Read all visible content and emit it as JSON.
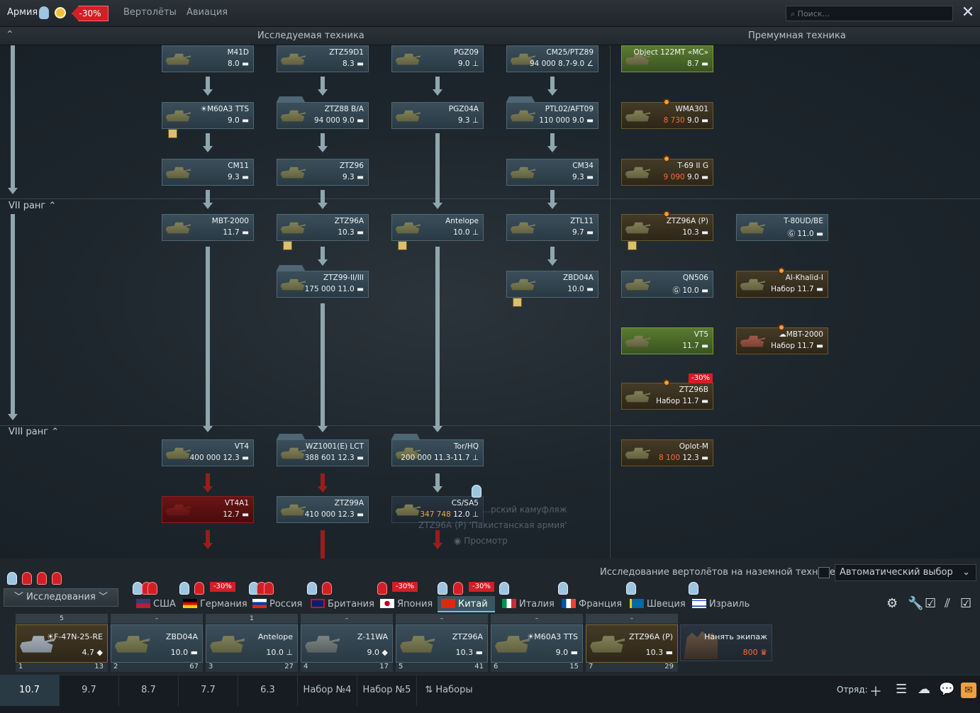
{
  "topbar": {
    "army_label": "Армия",
    "discount": "-30%",
    "tabs": [
      "Вертолёты",
      "Авиация"
    ],
    "search_placeholder": "Поиск..."
  },
  "headers": {
    "research": "Исследуемая техника",
    "premium": "Премумная техника"
  },
  "ranks": {
    "r7": "VII ранг",
    "r8": "VIII ранг"
  },
  "tree": {
    "col1": [
      {
        "name": "M41D",
        "val": "8.0"
      },
      {
        "name": "M60A3 TTS",
        "val": "9.0"
      },
      {
        "name": "CM11",
        "val": "9.3"
      },
      {
        "name": "MBT-2000",
        "val": "11.7"
      },
      {
        "name": "VT4",
        "cost": "400 000",
        "val": "12.3"
      },
      {
        "name": "VT4A1",
        "val": "12.7"
      }
    ],
    "col2": [
      {
        "name": "ZTZ59D1",
        "val": "8.3"
      },
      {
        "name": "ZTZ88 B/A",
        "cost": "94 000",
        "val": "9.0"
      },
      {
        "name": "ZTZ96",
        "val": "9.3"
      },
      {
        "name": "ZTZ96A",
        "val": "10.3"
      },
      {
        "name": "ZTZ99-II/III",
        "cost": "175 000",
        "val": "11.0"
      },
      {
        "name": "WZ1001(E) LCT",
        "cost": "388 601",
        "val": "12.3"
      },
      {
        "name": "ZTZ99A",
        "cost": "410 000",
        "val": "12.3"
      }
    ],
    "col3": [
      {
        "name": "PGZ09",
        "val": "9.0"
      },
      {
        "name": "PGZ04A",
        "val": "9.3"
      },
      {
        "name": "Antelope",
        "val": "10.0"
      },
      {
        "name": "Tor/HQ",
        "cost": "200 000",
        "val": "11.3-11.7"
      },
      {
        "name": "CS/SA5",
        "cost": "347 748",
        "val": "12.0"
      }
    ],
    "col4": [
      {
        "name": "CM25/PTZ89",
        "cost": "94 000",
        "val": "8.7-9.0"
      },
      {
        "name": "PTL02/AFT09",
        "cost": "110 000",
        "val": "9.0"
      },
      {
        "name": "CM34",
        "val": "9.3"
      },
      {
        "name": "ZTL11",
        "val": "9.7"
      },
      {
        "name": "ZBD04A",
        "val": "10.0"
      }
    ],
    "prem1": [
      {
        "name": "Object 122MT «MC»",
        "val": "8.7"
      },
      {
        "name": "WMA301",
        "cost": "8 730",
        "val": "9.0"
      },
      {
        "name": "T-69 II G",
        "cost": "9 090",
        "val": "9.0"
      },
      {
        "name": "ZTZ96A (P)",
        "val": "10.3"
      },
      {
        "name": "QN506",
        "val": "10.0"
      },
      {
        "name": "VT5",
        "val": "11.7"
      },
      {
        "name": "ZTZ96B",
        "cost": "Набор",
        "val": "11.7",
        "sale": "-30%"
      },
      {
        "name": "Oplot-M",
        "cost": "8 100",
        "val": "12.3"
      }
    ],
    "prem2": [
      {
        "name": "T-80UD/BE",
        "val": "11.0"
      },
      {
        "name": "Al-Khalid-I",
        "cost": "Набор",
        "val": "11.7"
      },
      {
        "name": "MBT-2000",
        "cost": "Набор",
        "val": "11.7"
      }
    ],
    "ghost": [
      "…рский камуфляж",
      "ZTZ96A (P) 'Пакистанская армия'",
      "Просмотр"
    ]
  },
  "research_button": "Исследования",
  "heli_option": "Исследование вертолётов на наземной технике",
  "auto_select": "Автоматический выбор",
  "nations": [
    "США",
    "Германия",
    "Россия",
    "Британия",
    "Япония",
    "Китай",
    "Италия",
    "Франция",
    "Швеция",
    "Израиль"
  ],
  "nation_sales": [
    "-30%",
    "-30%",
    "-30%"
  ],
  "crew": [
    {
      "top": "5",
      "name": "F-47N-25-RE",
      "val": "4.7",
      "slot": "1",
      "lvl": "13"
    },
    {
      "top": "–",
      "name": "ZBD04A",
      "val": "10.0",
      "slot": "2",
      "lvl": "67"
    },
    {
      "top": "1",
      "name": "Antelope",
      "val": "10.0",
      "slot": "3",
      "lvl": "27"
    },
    {
      "top": "–",
      "name": "Z-11WA",
      "val": "9.0",
      "slot": "4",
      "lvl": "17"
    },
    {
      "top": "–",
      "name": "ZTZ96A",
      "val": "10.3",
      "slot": "5",
      "lvl": "41"
    },
    {
      "top": "–",
      "name": "M60A3 TTS",
      "val": "9.0",
      "slot": "6",
      "lvl": "15"
    },
    {
      "top": "–",
      "name": "ZTZ96A (P)",
      "val": "10.3",
      "slot": "7",
      "lvl": "29"
    }
  ],
  "hire": {
    "label": "Нанять экипаж",
    "cost": "800"
  },
  "presets": [
    "10.7",
    "9.7",
    "8.7",
    "7.7",
    "6.3",
    "Набор №4",
    "Набор №5",
    "Наборы"
  ],
  "squad_label": "Отряд:"
}
